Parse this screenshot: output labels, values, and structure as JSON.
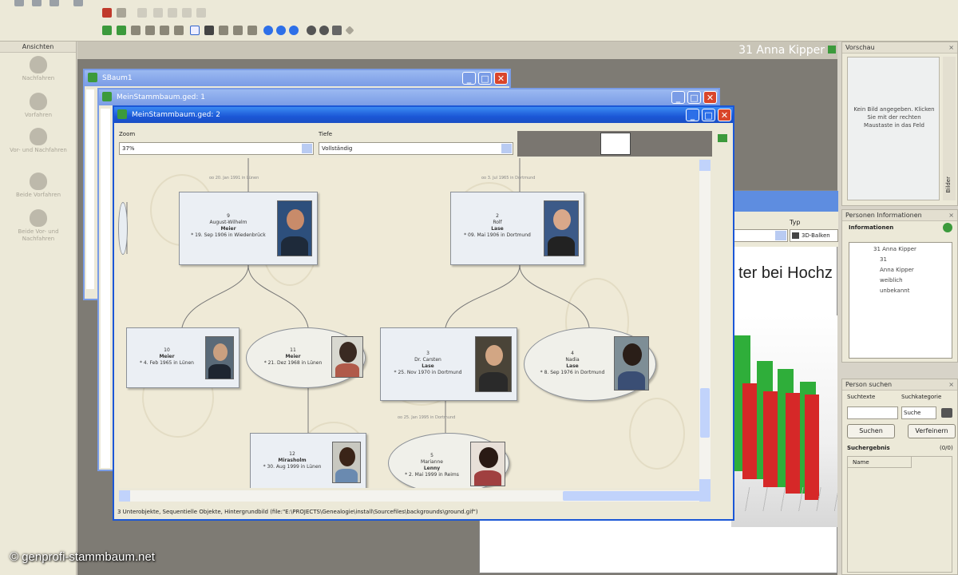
{
  "left_panel": {
    "header": "Ansichten",
    "items": [
      "Nachfahren",
      "Vorfahren",
      "Vor- und Nachfahren",
      "Beide Vorfahren",
      "Beide Vor- und Nachfahren"
    ]
  },
  "workspace": {
    "title": "31 Anna Kipper"
  },
  "windows": {
    "back": {
      "title": "SBaum1"
    },
    "middle": {
      "title": "MeinStammbaum.ged: 1"
    },
    "front": {
      "title": "MeinStammbaum.ged: 2",
      "zoom_label": "Zoom",
      "zoom_value": "37%",
      "depth_label": "Tiefe",
      "depth_value": "Vollständig",
      "status": "3 Unterobjekte, Sequentielle Objekte, Hintergrundbild (file:\"E:\\PROJECTS\\Genealogie\\install\\Sourcefiles\\backgrounds\\ground.gif\")"
    }
  },
  "tree": {
    "persons": [
      {
        "id": "p9",
        "num": "9",
        "name": "August-Wilhelm",
        "surname": "Meier",
        "date": "* 19. Sep 1906 in Wiedenbrück"
      },
      {
        "id": "p2",
        "num": "2",
        "name": "Rolf",
        "surname": "Lase",
        "date": "* 09. Mai 1906 in Dortmund"
      },
      {
        "id": "p10",
        "num": "10",
        "name": "Meier",
        "surname": "",
        "date": "* 4. Feb 1965 in Lünen"
      },
      {
        "id": "p11",
        "num": "11",
        "name": "Meier",
        "surname": "",
        "date": "* 21. Dez 1968 in Lünen"
      },
      {
        "id": "p3",
        "num": "3",
        "name": "Dr. Carsten",
        "surname": "Lase",
        "date": "* 25. Nov 1970 in Dortmund"
      },
      {
        "id": "p4",
        "num": "4",
        "name": "Nadia",
        "surname": "Lase",
        "date": "* 8. Sep 1976 in Dortmund"
      },
      {
        "id": "p12",
        "num": "12",
        "name": "Mirasholm",
        "surname": "",
        "date": "* 30. Aug 1999 in Lünen"
      },
      {
        "id": "p5",
        "num": "5",
        "name": "Marianne",
        "surname": "Lenny",
        "date": "* 2. Mai 1999 in Reims"
      }
    ],
    "wedding_labels": [
      "oo 20. Jan 1991 in Lünen",
      "oo 3. Jul 1965 in Dortmund",
      "oo 25. Jan 1995 in Dortmund"
    ]
  },
  "behind": {
    "type_label": "Typ",
    "type_value": "3D-Balken",
    "chart_title": "ter bei Hochz"
  },
  "preview": {
    "header": "Vorschau",
    "text": "Kein Bild angegeben. Klicken Sie mit der rechten Maustaste in das Feld",
    "side_label": "Bilder"
  },
  "person_info": {
    "header": "Personen Informationen",
    "subheader": "Informationen",
    "tree": [
      "31 Anna Kipper",
      "31",
      "Anna Kipper",
      "weiblich",
      "unbekannt"
    ]
  },
  "person_search": {
    "header": "Person suchen",
    "term_label": "Suchtexte",
    "category_label": "Suchkategorie",
    "category_value": "Suche",
    "search_button": "Suchen",
    "refine_button": "Verfeinern",
    "result_label": "Suchergebnis",
    "result_count": "(0/0)",
    "result_column": "Name"
  },
  "watermark": "© genprofi-stammbaum.net",
  "colors": {
    "title_bar": "#1b57d6",
    "close": "#d9462b",
    "canvas": "#efead7",
    "bar_red": "#d62828",
    "bar_green": "#2fae3a"
  }
}
